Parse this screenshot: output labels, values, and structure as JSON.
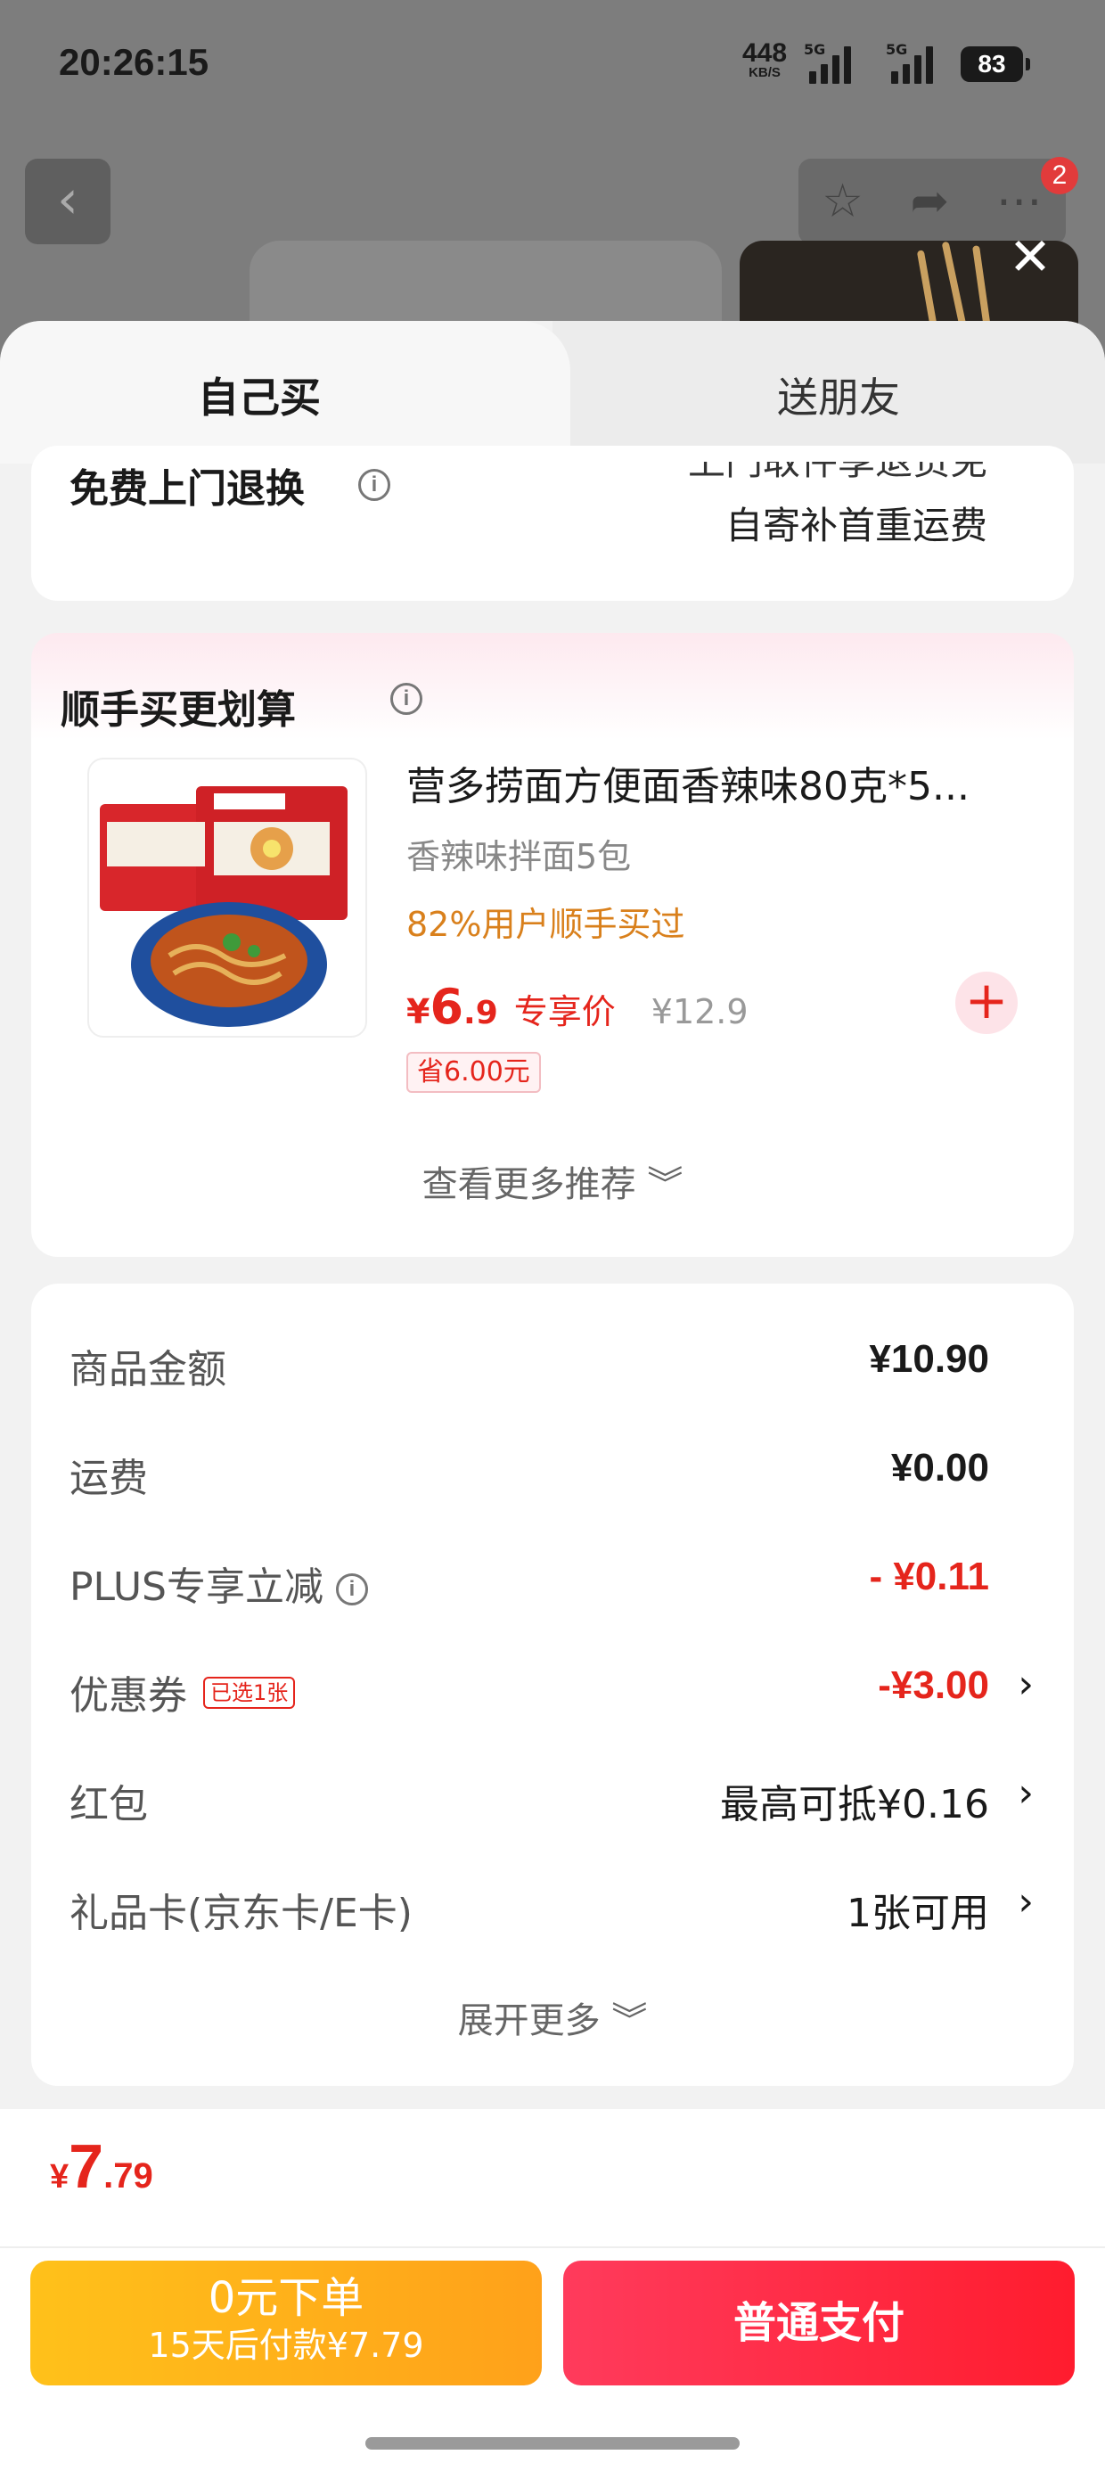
{
  "status": {
    "time": "20:26:15",
    "net_speed": "448",
    "net_unit": "KB/S",
    "sig1_tag": "5G",
    "sig2_tag": "5G",
    "battery": "83"
  },
  "background": {
    "badge_count": "2"
  },
  "tabs": {
    "self": "自己买",
    "gift": "送朋友"
  },
  "return_service": {
    "title": "免费上门退换",
    "line1": "上门取件享退货免",
    "line2": "自寄补首重运费"
  },
  "recommend": {
    "title": "顺手买更划算",
    "product": {
      "name": "营多捞面方便面香辣味80克*5...",
      "spec": "香辣味拌面5包",
      "tip": "82%用户顺手买过",
      "price_symbol": "¥",
      "price_int": "6",
      "price_dec": ".9",
      "price_label": "专享价",
      "orig_price": "¥12.9",
      "save": "省6.00元"
    },
    "more": "查看更多推荐 ︾"
  },
  "summary": {
    "rows": [
      {
        "label": "商品金额",
        "value": "¥10.90"
      },
      {
        "label": "运费",
        "value": "¥0.00"
      },
      {
        "label": "PLUS专享立减",
        "value": "- ¥0.11"
      },
      {
        "label": "优惠券",
        "tag": "已选1张",
        "value": "-¥3.00"
      },
      {
        "label": "红包",
        "value": "最高可抵¥0.16"
      },
      {
        "label": "礼品卡(京东卡/E卡)",
        "value": "1张可用"
      }
    ],
    "expand": "展开更多 ︾"
  },
  "bottom": {
    "total_symbol": "¥",
    "total_int": "7",
    "total_dec": ".79",
    "btn_zero_line1": "0元下单",
    "btn_zero_line2": "15天后付款¥7.79",
    "btn_pay": "普通支付"
  }
}
